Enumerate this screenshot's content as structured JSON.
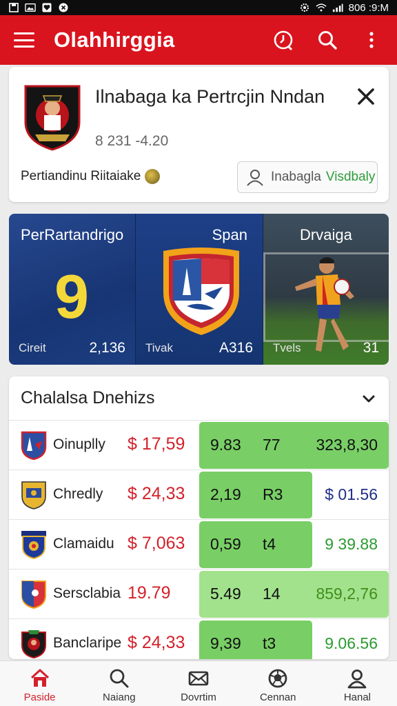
{
  "status_bar": {
    "time": "806 :9:M"
  },
  "app_bar": {
    "title": "Olahhirggia"
  },
  "match_card": {
    "title": "Ilnabaga ka Pertrcjin Nndan",
    "subtitle": "8 231 -4.20",
    "status_text": "Pertiandinu Riitaiake",
    "watch_button": {
      "label": "Inabagla",
      "accent": "Visdbaly"
    }
  },
  "hero": {
    "panels": [
      {
        "title": "PerRartandrigo",
        "big_number": "9",
        "footer_label": "Cireit",
        "footer_value": "2,136"
      },
      {
        "title": "Span",
        "footer_label": "Tivak",
        "footer_value": "A316"
      },
      {
        "title": "Drvaiga",
        "footer_label": "Tvels",
        "footer_value": "31"
      }
    ]
  },
  "table": {
    "title": "Chalalsa Dnehizs",
    "rows": [
      {
        "team": "Oinuplly",
        "price": "$ 17,59",
        "v1": "9.83",
        "v2": "77",
        "v3": "323,8,30"
      },
      {
        "team": "Chredly",
        "price": "$ 24,33",
        "v1": "2,19",
        "v2": "R3",
        "v3": "$ 01.56"
      },
      {
        "team": "Clamaidu",
        "price": "$ 7,063",
        "v1": "0,59",
        "v2": "t4",
        "v3": "9 39.88"
      },
      {
        "team": "Sersclabia",
        "price": "19.79",
        "v1": "5.49",
        "v2": "14",
        "v3": "859,2,76"
      },
      {
        "team": "Banclaripe",
        "price": "$ 24,33",
        "v1": "9,39",
        "v2": "t3",
        "v3": "9.06.56"
      }
    ]
  },
  "bottom_nav": [
    {
      "label": "Paside",
      "icon": "home-icon",
      "active": true
    },
    {
      "label": "Naiang",
      "icon": "search-icon"
    },
    {
      "label": "Dovrtim",
      "icon": "mail-icon"
    },
    {
      "label": "Cennan",
      "icon": "ball-icon"
    },
    {
      "label": "Hanal",
      "icon": "profile-icon"
    }
  ],
  "colors": {
    "primary_red": "#d9141e",
    "hero_blue": "#173574",
    "accent_green": "#79cf66",
    "price_red": "#d3212b"
  }
}
